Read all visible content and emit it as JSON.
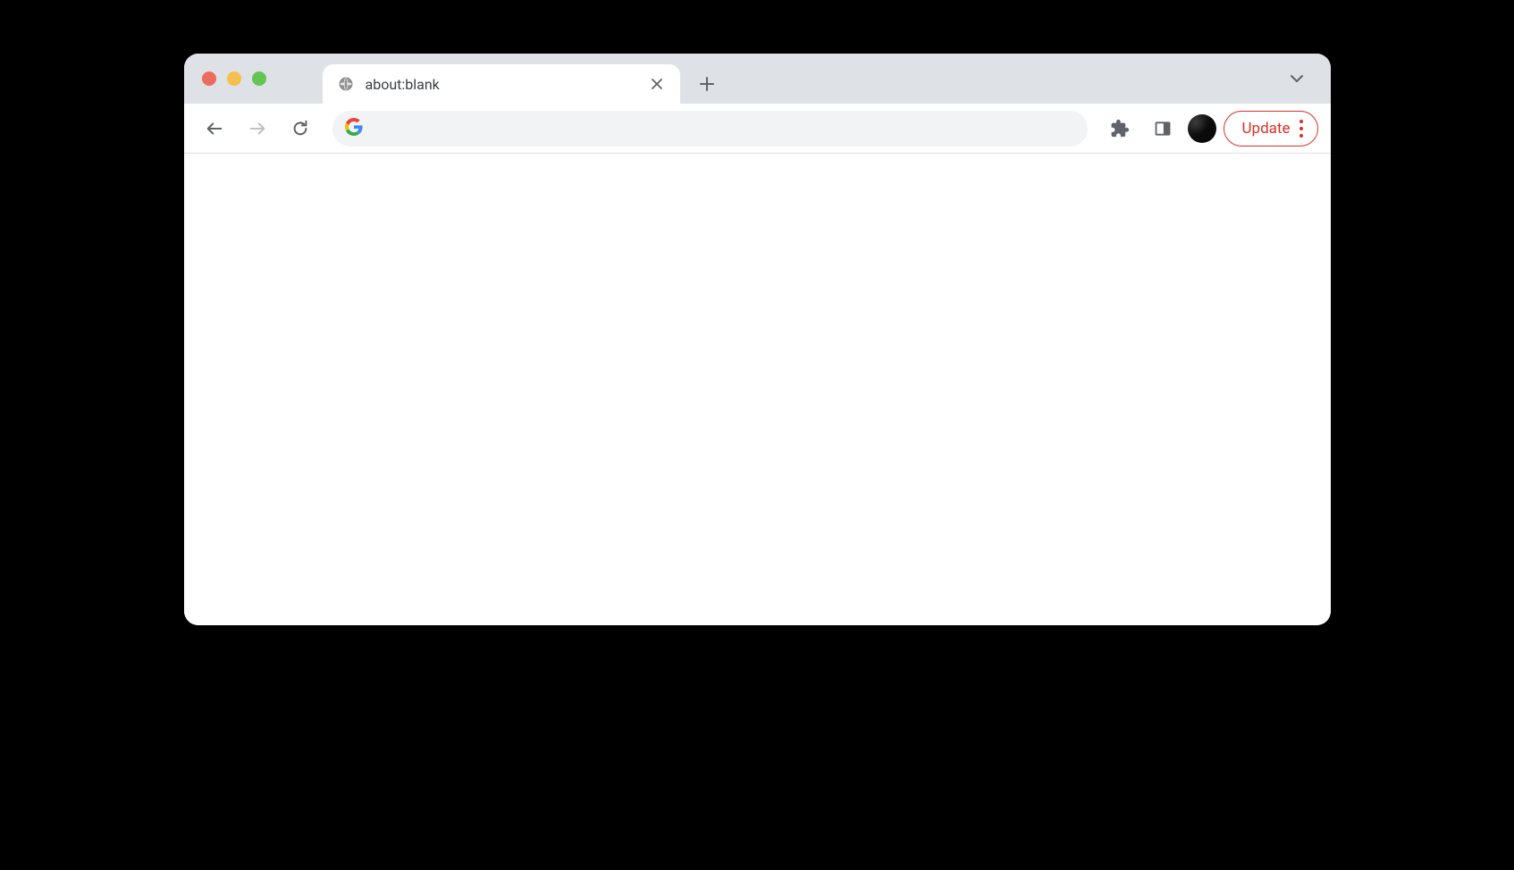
{
  "tabs": [
    {
      "title": "about:blank"
    }
  ],
  "toolbar": {
    "address_value": "",
    "update_label": "Update"
  },
  "colors": {
    "accent_red": "#d93025",
    "tab_strip_bg": "#dee1e6",
    "address_bar_bg": "#f1f3f4"
  }
}
